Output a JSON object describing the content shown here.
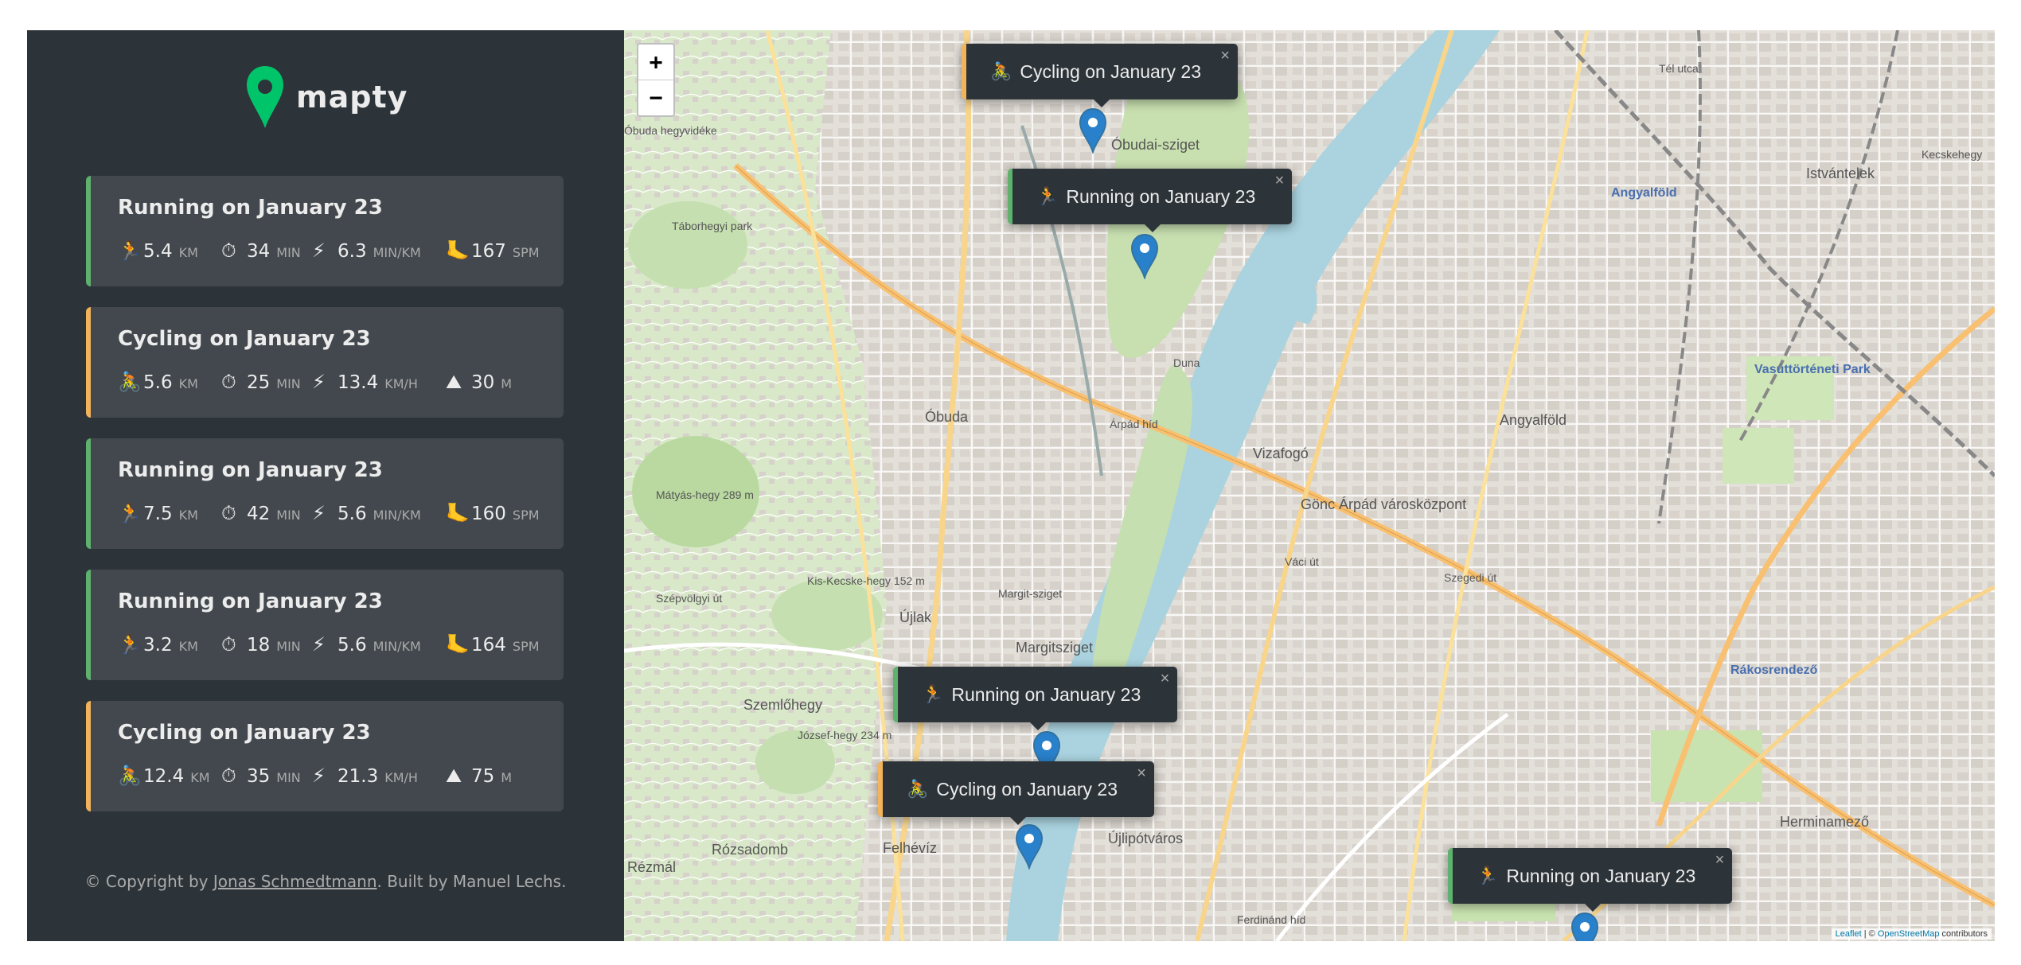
{
  "app": {
    "name": "mapty"
  },
  "colors": {
    "running": "#5fb26e",
    "cycling": "#f2b35b",
    "sidebar": "#2d3439",
    "card": "#42484d"
  },
  "workouts": [
    {
      "type": "running",
      "title": "Running on January 23",
      "d1": {
        "icon": "running-icon",
        "value": "5.4",
        "unit": "km"
      },
      "d2": {
        "icon": "stopwatch-icon",
        "value": "34",
        "unit": "min"
      },
      "d3": {
        "icon": "lightning-icon",
        "value": "6.3",
        "unit": "min/km"
      },
      "d4": {
        "icon": "footprint-icon",
        "value": "167",
        "unit": "spm"
      }
    },
    {
      "type": "cycling",
      "title": "Cycling on January 23",
      "d1": {
        "icon": "cycling-icon",
        "value": "5.6",
        "unit": "km"
      },
      "d2": {
        "icon": "stopwatch-icon",
        "value": "25",
        "unit": "min"
      },
      "d3": {
        "icon": "lightning-icon",
        "value": "13.4",
        "unit": "km/h"
      },
      "d4": {
        "icon": "mountain-icon",
        "value": "30",
        "unit": "m"
      }
    },
    {
      "type": "running",
      "title": "Running on January 23",
      "d1": {
        "icon": "running-icon",
        "value": "7.5",
        "unit": "km"
      },
      "d2": {
        "icon": "stopwatch-icon",
        "value": "42",
        "unit": "min"
      },
      "d3": {
        "icon": "lightning-icon",
        "value": "5.6",
        "unit": "min/km"
      },
      "d4": {
        "icon": "footprint-icon",
        "value": "160",
        "unit": "spm"
      }
    },
    {
      "type": "running",
      "title": "Running on January 23",
      "d1": {
        "icon": "running-icon",
        "value": "3.2",
        "unit": "km"
      },
      "d2": {
        "icon": "stopwatch-icon",
        "value": "18",
        "unit": "min"
      },
      "d3": {
        "icon": "lightning-icon",
        "value": "5.6",
        "unit": "min/km"
      },
      "d4": {
        "icon": "footprint-icon",
        "value": "164",
        "unit": "spm"
      }
    },
    {
      "type": "cycling",
      "title": "Cycling on January 23",
      "d1": {
        "icon": "cycling-icon",
        "value": "12.4",
        "unit": "km"
      },
      "d2": {
        "icon": "stopwatch-icon",
        "value": "35",
        "unit": "min"
      },
      "d3": {
        "icon": "lightning-icon",
        "value": "21.3",
        "unit": "km/h"
      },
      "d4": {
        "icon": "mountain-icon",
        "value": "75",
        "unit": "m"
      }
    }
  ],
  "footer": {
    "prefix": "© Copyright by ",
    "link": "Jonas Schmedtmann",
    "suffix": ". Built by Manuel Lechs."
  },
  "map": {
    "zoom_in": "+",
    "zoom_out": "−",
    "popups": [
      {
        "type": "cycling",
        "text": "Cycling on January 23",
        "close": "×"
      },
      {
        "type": "running",
        "text": "Running on January 23",
        "close": "×"
      },
      {
        "type": "running",
        "text": "Running on January 23",
        "close": "×"
      },
      {
        "type": "cycling",
        "text": "Cycling on January 23",
        "close": "×"
      },
      {
        "type": "running",
        "text": "Running on January 23",
        "close": "×"
      }
    ],
    "attribution": {
      "leaflet": "Leaflet",
      "sep": " | © ",
      "osm": "OpenStreetMap",
      "contributors": " contributors"
    },
    "labels": [
      "Óbudai-sziget",
      "Óbuda",
      "Árpád híd",
      "Vizafogó",
      "Gönc Árpád városközpont",
      "Angyalföld",
      "Angyalföld",
      "Istvántelek",
      "Kecskehegy",
      "Vasúttörténeti Park",
      "Rákosrendező",
      "Margitsziget",
      "Újlak",
      "Szemlőhegy",
      "Rózsadomb",
      "Felhévíz",
      "Újlipótváros",
      "Herminamező",
      "Mátyás-hegy 289 m",
      "Kis-Kecske-hegy 152 m",
      "József-hegy 234 m",
      "Táborhegyi park",
      "Óbuda hegyvidéke",
      "Duna",
      "Rézmál",
      "Tél utca",
      "Margit-sziget",
      "Ferdinánd híd",
      "Szépvölgyi út",
      "Szegedi út",
      "Váci út"
    ]
  }
}
